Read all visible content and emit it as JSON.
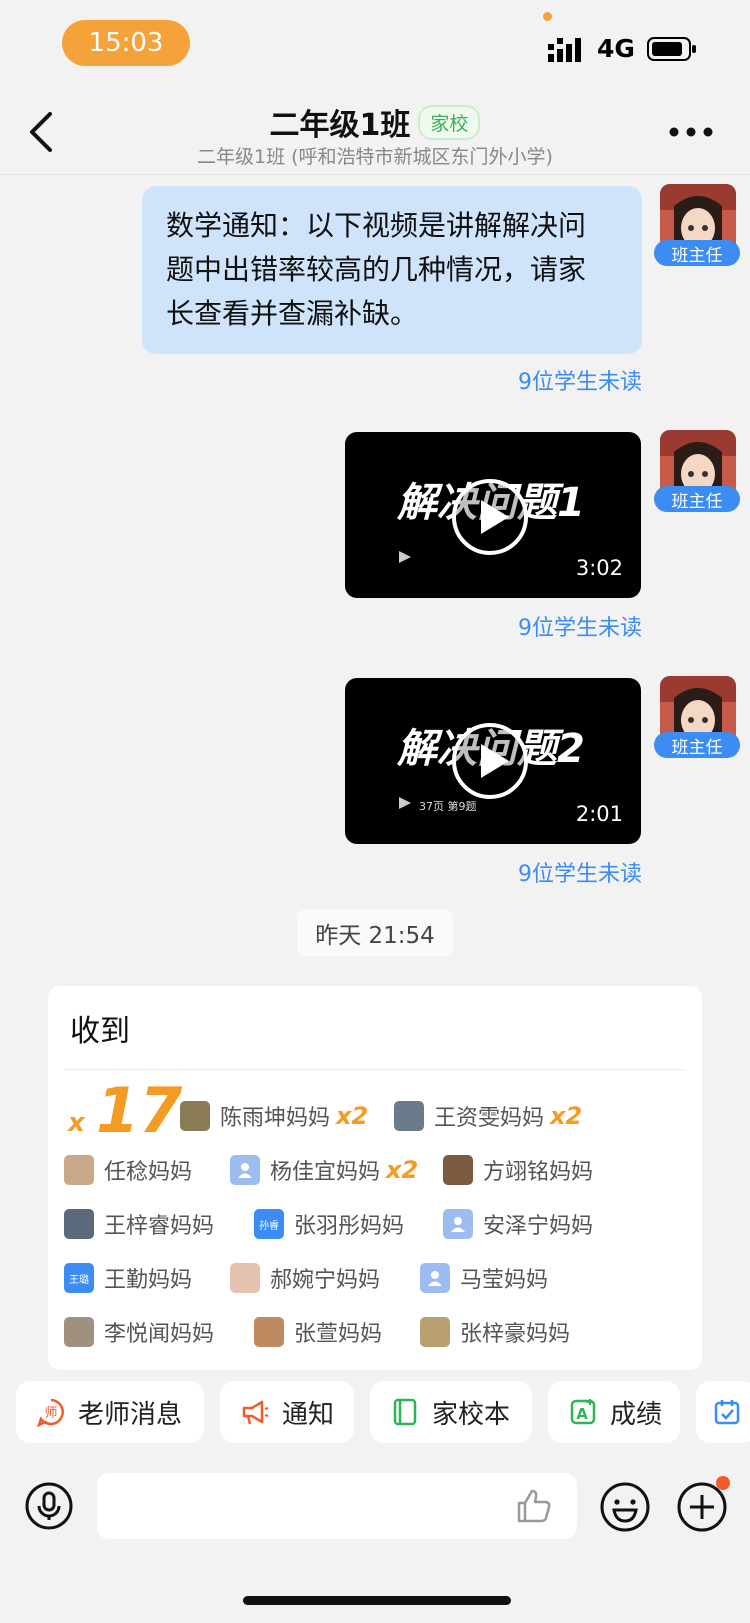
{
  "status": {
    "time": "15:03",
    "network": "4G"
  },
  "header": {
    "title": "二年级1班",
    "tag": "家校",
    "subtitle": "二年级1班 (呼和浩特市新城区东门外小学)"
  },
  "messages": [
    {
      "type": "text",
      "sender_role": "班主任",
      "text": "数学通知：以下视频是讲解解决问题中出错率较高的几种情况，请家长查看并查漏补缺。",
      "unread": "9位学生未读"
    },
    {
      "type": "video",
      "sender_role": "班主任",
      "title": "解决问题1",
      "duration": "3:02",
      "caption": "",
      "unread": "9位学生未读"
    },
    {
      "type": "video",
      "sender_role": "班主任",
      "title": "解决问题2",
      "duration": "2:01",
      "caption": "37页 第9题",
      "unread": "9位学生未读"
    }
  ],
  "timestamp": "昨天 21:54",
  "receipt": {
    "title": "收到",
    "count_prefix": "x",
    "count": "17",
    "people": [
      {
        "name": "陈雨坤妈妈",
        "mult": "x2"
      },
      {
        "name": "王资雯妈妈",
        "mult": "x2"
      },
      {
        "name": "任稔妈妈",
        "mult": ""
      },
      {
        "name": "杨佳宜妈妈",
        "mult": "x2"
      },
      {
        "name": "方翊铭妈妈",
        "mult": ""
      },
      {
        "name": "王梓睿妈妈",
        "mult": ""
      },
      {
        "name": "张羽彤妈妈",
        "mult": "",
        "avatar_text": "孙睿"
      },
      {
        "name": "安泽宁妈妈",
        "mult": ""
      },
      {
        "name": "王勤妈妈",
        "mult": "",
        "avatar_text": "王璐"
      },
      {
        "name": "郝婉宁妈妈",
        "mult": ""
      },
      {
        "name": "马莹妈妈",
        "mult": ""
      },
      {
        "name": "李悦闻妈妈",
        "mult": ""
      },
      {
        "name": "张萱妈妈",
        "mult": ""
      },
      {
        "name": "张梓豪妈妈",
        "mult": ""
      }
    ]
  },
  "quick_actions": [
    {
      "label": "老师消息",
      "icon": "teacher-message-icon",
      "color": "#f25a2c"
    },
    {
      "label": "通知",
      "icon": "megaphone-icon",
      "color": "#f25a2c"
    },
    {
      "label": "家校本",
      "icon": "notebook-icon",
      "color": "#2fb454"
    },
    {
      "label": "成绩",
      "icon": "grade-icon",
      "color": "#2fb454"
    },
    {
      "label": "",
      "icon": "calendar-check-icon",
      "color": "#3b8cf3"
    }
  ],
  "colors": {
    "accent_orange": "#f39b22",
    "blue": "#3b8cf3",
    "bubble": "#cfe3fb"
  }
}
